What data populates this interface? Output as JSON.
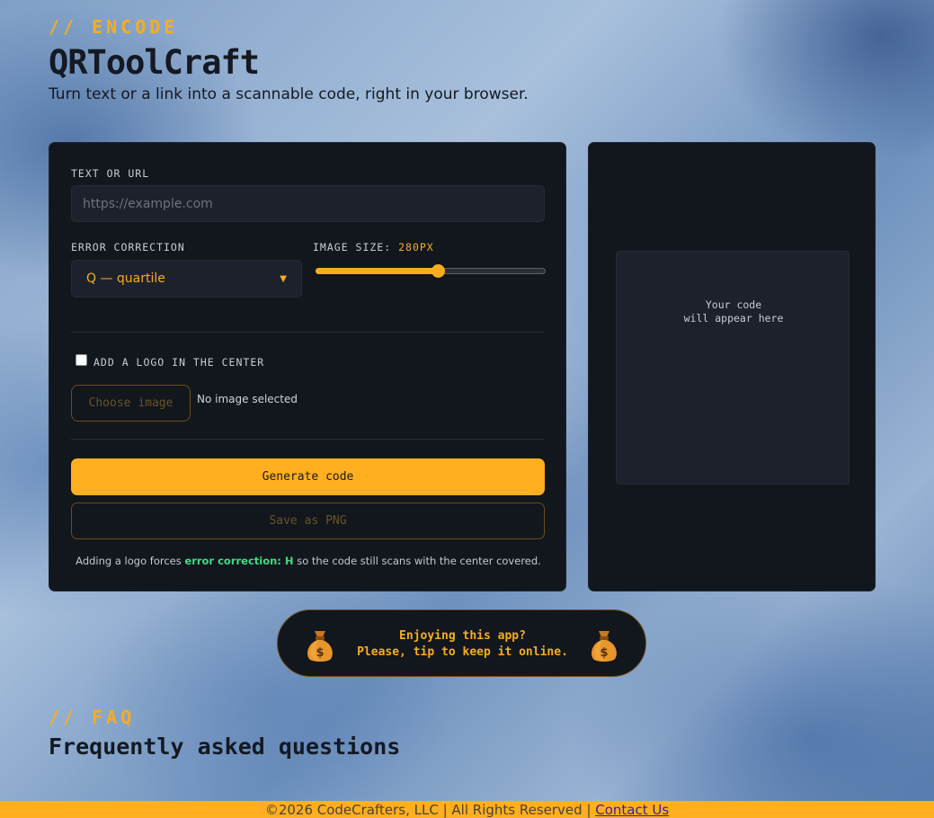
{
  "header": {
    "kicker": "// ENCODE",
    "title": "QRToolCraft",
    "subtitle": "Turn text or a link into a scannable code, right in your browser."
  },
  "form": {
    "text_label": "TEXT OR URL",
    "text_placeholder": "https://example.com",
    "text_value": "",
    "error_label": "ERROR CORRECTION",
    "error_selected": "Q — quartile",
    "size_label": "IMAGE SIZE:",
    "size_value": "280PX",
    "size_fraction": 0.53,
    "logo_label": "ADD A LOGO IN THE CENTER",
    "logo_checked": false,
    "choose_label": "Choose image",
    "no_image_text": "No image selected",
    "generate_label": "Generate code",
    "save_label": "Save as PNG",
    "note_before": "Adding a logo forces ",
    "note_highlight": "error correction: H",
    "note_after": " so the code still scans with the center covered."
  },
  "preview": {
    "placeholder": "Your code\nwill appear here"
  },
  "tip": {
    "line1": "Enjoying this app?",
    "line2": "Please, tip to keep it online."
  },
  "faq": {
    "kicker": "// FAQ",
    "title": "Frequently asked questions"
  },
  "footer": {
    "text": "©2026 CodeCrafters, LLC | All Rights Reserved | ",
    "contact_label": "Contact Us"
  },
  "colors": {
    "accent": "#ffaf1f",
    "card": "#12161d",
    "highlight": "#3ddc84"
  },
  "icons": {
    "tip": "money-bag-icon",
    "select": "chevron-down-icon"
  }
}
